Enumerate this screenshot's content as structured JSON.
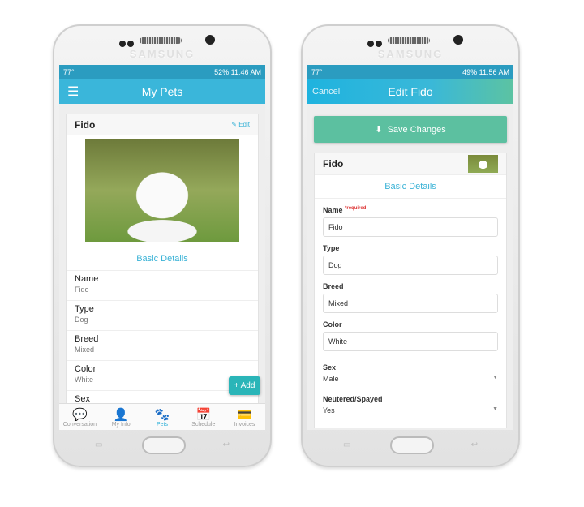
{
  "brand": "SAMSUNG",
  "phone1": {
    "status": {
      "left": "77°",
      "battery": "52%",
      "time": "11:46 AM"
    },
    "header": {
      "title": "My Pets",
      "menu_icon": "hamburger-icon"
    },
    "card": {
      "pet_name": "Fido",
      "edit_label": "Edit",
      "section": "Basic Details",
      "rows": [
        {
          "label": "Name",
          "value": "Fido"
        },
        {
          "label": "Type",
          "value": "Dog"
        },
        {
          "label": "Breed",
          "value": "Mixed"
        },
        {
          "label": "Color",
          "value": "White"
        },
        {
          "label": "Sex",
          "value": ""
        }
      ]
    },
    "add_label": "+ Add",
    "nav": [
      {
        "label": "Conversation",
        "icon": "chat-icon"
      },
      {
        "label": "My Info",
        "icon": "person-icon"
      },
      {
        "label": "Pets",
        "icon": "paw-icon",
        "active": true
      },
      {
        "label": "Schedule",
        "icon": "calendar-icon"
      },
      {
        "label": "Invoices",
        "icon": "card-icon"
      }
    ]
  },
  "phone2": {
    "status": {
      "left": "77°",
      "battery": "49%",
      "time": "11:56 AM"
    },
    "header": {
      "title": "Edit Fido",
      "cancel": "Cancel"
    },
    "save_label": "Save Changes",
    "card": {
      "pet_name": "Fido",
      "section": "Basic Details",
      "required": "*required",
      "fields": [
        {
          "label": "Name",
          "value": "Fido"
        },
        {
          "label": "Type",
          "value": "Dog"
        },
        {
          "label": "Breed",
          "value": "Mixed"
        },
        {
          "label": "Color",
          "value": "White"
        }
      ],
      "selects": [
        {
          "label": "Sex",
          "value": "Male"
        },
        {
          "label": "Neutered/Spayed",
          "value": "Yes"
        }
      ]
    }
  },
  "colors": {
    "header": "#3ab6da",
    "save": "#5cc0a0",
    "accent": "#39b2d6"
  }
}
